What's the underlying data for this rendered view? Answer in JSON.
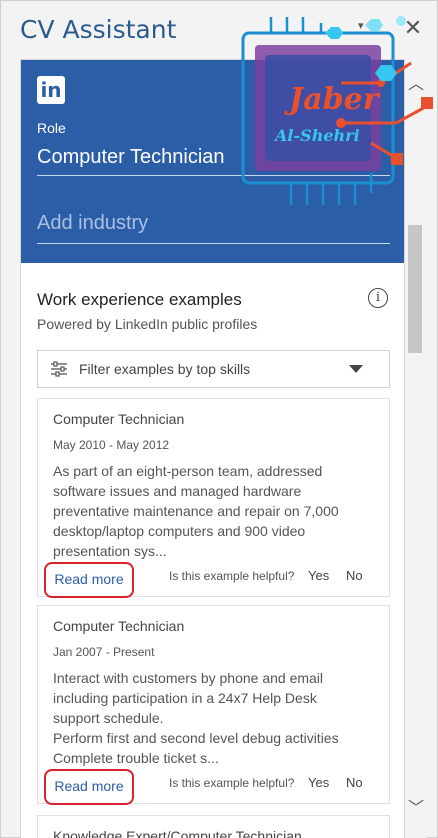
{
  "window": {
    "title": "CV Assistant",
    "close_glyph": "✕"
  },
  "hero": {
    "logo_text": "in",
    "role_label": "Role",
    "role_value": "Computer Technician",
    "industry_placeholder": "Add industry"
  },
  "watermark": {
    "text_line1": "Jaber",
    "text_line2": "Al-Shehri"
  },
  "section": {
    "title": "Work experience examples",
    "powered_by": "Powered by LinkedIn public profiles",
    "info_glyph": "i"
  },
  "filter": {
    "label": "Filter examples by top skills"
  },
  "cards": [
    {
      "title": "Computer Technician",
      "dates": "May 2010 - May 2012",
      "body": "As part of an eight-person team, addressed\nsoftware issues and managed hardware\npreventative maintenance and repair on 7,000\ndesktop/laptop computers and 900 video\npresentation sys...",
      "read_more": "Read more",
      "helpful_question": "Is this example helpful?",
      "yes": "Yes",
      "no": "No"
    },
    {
      "title": "Computer Technician",
      "dates": "Jan 2007 - Present",
      "body": "Interact with customers by phone and email\nincluding participation in a 24x7 Help Desk\nsupport schedule.\nPerform first and second level debug activities\nComplete trouble ticket s...",
      "read_more": "Read more",
      "helpful_question": "Is this example helpful?",
      "yes": "Yes",
      "no": "No"
    },
    {
      "title": "Knowledge Expert/Computer Technician"
    }
  ],
  "colors": {
    "hero_bg": "#2c5ea8",
    "title_color": "#2b5b8c",
    "highlight_red": "#d9232e",
    "link_blue": "#2c5ea8"
  },
  "icons": {
    "close": "close-icon",
    "info": "info-icon",
    "filter": "sliders-icon",
    "dropdown": "chevron-down-icon",
    "scroll_up": "chevron-up-icon",
    "scroll_down": "chevron-down-icon"
  }
}
